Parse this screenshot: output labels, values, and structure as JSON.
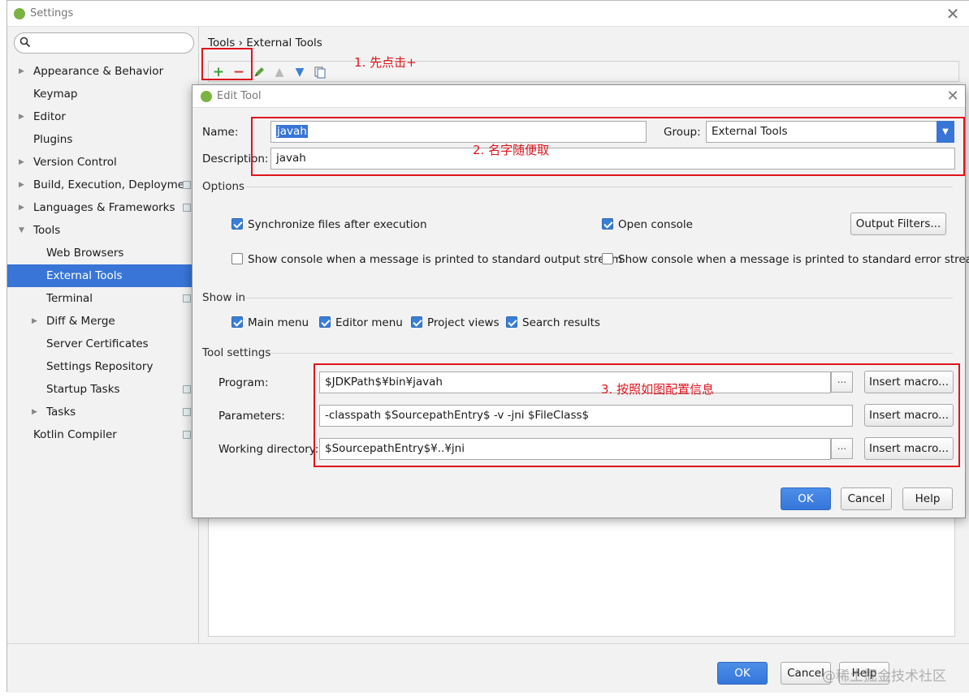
{
  "settings_window": {
    "title": "Settings",
    "search": {
      "value": "",
      "placeholder": ""
    },
    "nav_items": [
      {
        "label": "Appearance & Behavior",
        "expandable": true
      },
      {
        "label": "Keymap",
        "expandable": false
      },
      {
        "label": "Editor",
        "expandable": true
      },
      {
        "label": "Plugins",
        "expandable": false
      },
      {
        "label": "Version Control",
        "expandable": true
      },
      {
        "label": "Build, Execution, Deployment",
        "expandable": true
      },
      {
        "label": "Languages & Frameworks",
        "expandable": true
      },
      {
        "label": "Tools",
        "expandable": true,
        "expanded": true
      },
      {
        "label": "Web Browsers",
        "expandable": false
      },
      {
        "label": "External Tools",
        "expandable": false,
        "selected": true
      },
      {
        "label": "Terminal",
        "expandable": false
      },
      {
        "label": "Diff & Merge",
        "expandable": true
      },
      {
        "label": "Server Certificates",
        "expandable": false
      },
      {
        "label": "Settings Repository",
        "expandable": false
      },
      {
        "label": "Startup Tasks",
        "expandable": false
      },
      {
        "label": "Tasks",
        "expandable": true
      },
      {
        "label": "Kotlin Compiler",
        "expandable": false
      }
    ],
    "breadcrumb": {
      "parent": "Tools",
      "separator": "›",
      "current": "External Tools"
    },
    "toolbar": {
      "add": "+",
      "remove": "−",
      "edit": "edit-icon",
      "up": "arrow-up-icon",
      "down": "arrow-down-icon",
      "copy": "copy-icon"
    },
    "buttons": {
      "ok": "OK",
      "cancel": "Cancel",
      "help": "Help"
    }
  },
  "edit_tool_dialog": {
    "title": "Edit Tool",
    "name_label": "Name:",
    "name_value": "javah",
    "group_label": "Group:",
    "group_value": "External Tools",
    "description_label": "Description:",
    "description_value": "javah",
    "options_title": "Options",
    "options": {
      "sync_files": {
        "label": "Synchronize files after execution",
        "checked": true
      },
      "open_console": {
        "label": "Open console",
        "checked": true
      },
      "show_console_stdout": {
        "label": "Show console when a message is printed to standard output stream",
        "checked": false
      },
      "show_console_stderr": {
        "label": "Show console when a message is printed to standard error stream",
        "checked": false
      },
      "output_filters_button": "Output Filters..."
    },
    "show_in_title": "Show in",
    "show_in": {
      "main_menu": {
        "label": "Main menu",
        "checked": true
      },
      "editor_menu": {
        "label": "Editor menu",
        "checked": true
      },
      "project_views": {
        "label": "Project views",
        "checked": true
      },
      "search_results": {
        "label": "Search results",
        "checked": true
      }
    },
    "tool_settings_title": "Tool settings",
    "program_label": "Program:",
    "program_value": "$JDKPath$¥bin¥javah",
    "parameters_label": "Parameters:",
    "parameters_value": "-classpath $SourcepathEntry$ -v -jni $FileClass$",
    "working_dir_label": "Working directory:",
    "working_dir_value": "$SourcepathEntry$¥..¥jni",
    "insert_macro_label": "Insert macro...",
    "browse_label": "...",
    "buttons": {
      "ok": "OK",
      "cancel": "Cancel",
      "help": "Help"
    }
  },
  "annotations": {
    "step1": "1. 先点击+",
    "step2": "2. 名字随便取",
    "step3": "3. 按照如图配置信息"
  },
  "watermark": "@稀土掘金技术社区",
  "colors": {
    "accent": "#3875d7",
    "annotation_red": "#e0141e",
    "checkbox_blue": "#3a7fd5",
    "add_green": "#3ca33c",
    "remove_red": "#d9352b"
  }
}
